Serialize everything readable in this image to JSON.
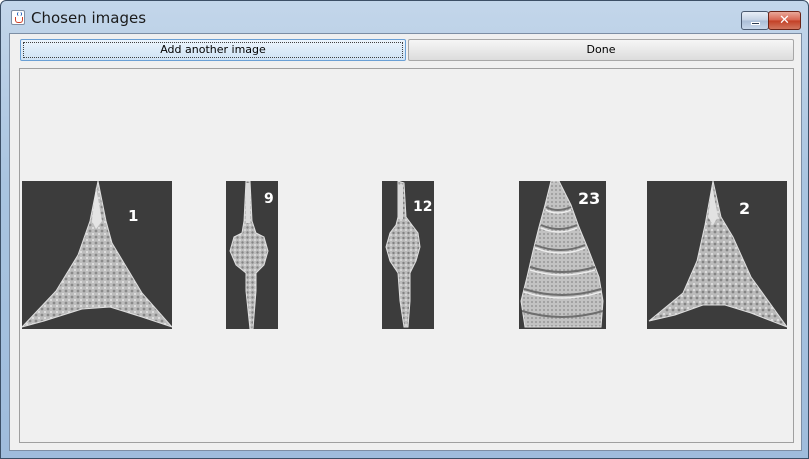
{
  "window": {
    "title": "Chosen images"
  },
  "toolbar": {
    "add_label": "Add another image",
    "done_label": "Done"
  },
  "images": [
    {
      "label": "1",
      "shape": "triangular-spiked-microfossil"
    },
    {
      "label": "9",
      "shape": "spindle-spiked-microfossil"
    },
    {
      "label": "12",
      "shape": "spindle-spiked-microfossil"
    },
    {
      "label": "23",
      "shape": "conical-ringed-microfossil"
    },
    {
      "label": "2",
      "shape": "triangular-spiked-microfossil"
    }
  ],
  "colors": {
    "thumb_background": "#3c3c3c",
    "fossil": "#cfcfcf",
    "label": "#ffffff"
  },
  "icons": {
    "app": "java-coffee-cup-icon",
    "minimize": "minimize-icon",
    "close": "close-icon"
  }
}
